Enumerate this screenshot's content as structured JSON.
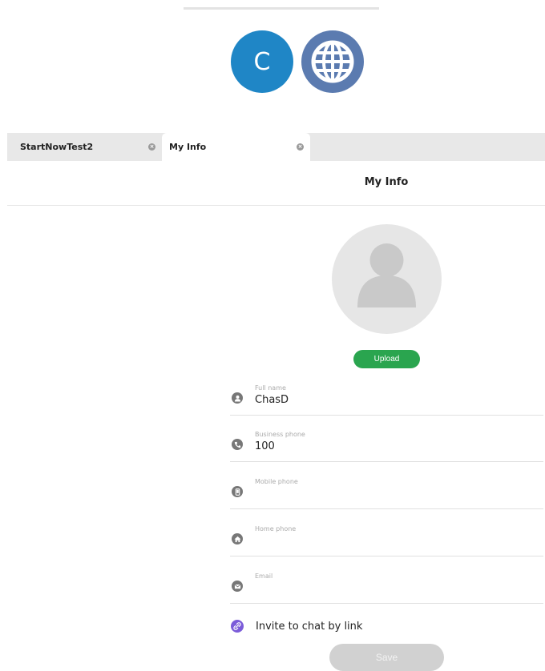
{
  "header": {
    "avatar_letter": "C",
    "avatar_color": "#1f86c6",
    "globe_color": "#5b7bb0",
    "globe_icon": "globe-icon"
  },
  "tabs": [
    {
      "label": "StartNowTest2",
      "close_icon": "close-icon"
    },
    {
      "label": "My Info",
      "close_icon": "close-icon",
      "active": true
    }
  ],
  "page": {
    "title": "My Info",
    "photo_icon": "person-silhouette-icon",
    "upload_label": "Upload",
    "upload_color": "#2aa54f"
  },
  "fields": [
    {
      "label": "Full name",
      "value": "ChasD",
      "icon": "person-icon"
    },
    {
      "label": "Business phone",
      "value": "100",
      "icon": "phone-icon"
    },
    {
      "label": "Mobile phone",
      "value": "",
      "icon": "mobile-icon"
    },
    {
      "label": "Home phone",
      "value": "",
      "icon": "home-icon"
    },
    {
      "label": "Email",
      "value": "",
      "icon": "envelope-icon"
    }
  ],
  "invite": {
    "label": "Invite to chat by link",
    "icon": "link-icon",
    "icon_color": "#7b5cd9"
  },
  "save_label": "Save"
}
